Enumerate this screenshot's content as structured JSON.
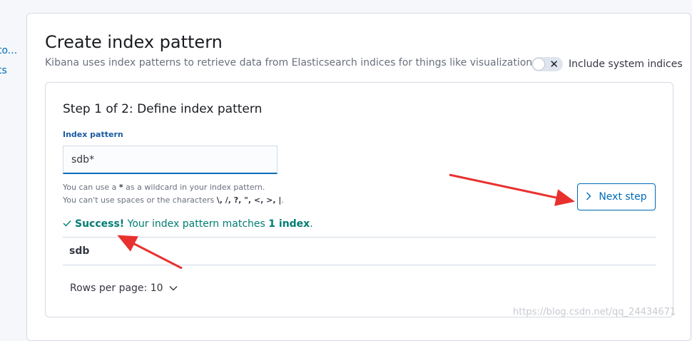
{
  "left_nav": {
    "items": [
      {
        "label": "to..."
      },
      {
        "label": "ts"
      }
    ]
  },
  "header": {
    "title": "Create index pattern",
    "description": "Kibana uses index patterns to retrieve data from Elasticsearch indices for things like visualizations.",
    "toggle_label": "Include system indices",
    "toggle_on": false
  },
  "step": {
    "title": "Step 1 of 2: Define index pattern",
    "field_label": "Index pattern",
    "field_value": "sdb*",
    "help_line1_prefix": "You can use a ",
    "help_line1_wildcard": "*",
    "help_line1_suffix": " as a wildcard in your index pattern.",
    "help_line2_prefix": "You can't use spaces or the characters ",
    "help_line2_chars": "\\, /, ?, \", <, >, |",
    "help_line2_suffix": "."
  },
  "next_button": {
    "label": "Next step",
    "icon": "chevron-right-icon"
  },
  "success": {
    "icon": "check-icon",
    "strong": "Success!",
    "text": " Your index pattern matches ",
    "count": "1 index",
    "end": "."
  },
  "table": {
    "rows": [
      "sdb"
    ]
  },
  "pagination": {
    "label": "Rows per page: 10",
    "icon": "chevron-down-icon"
  },
  "colors": {
    "accent": "#006bb8",
    "success": "#017d73",
    "annotation_arrow": "#e8312f"
  },
  "watermark": "https://blog.csdn.net/qq_24434671"
}
